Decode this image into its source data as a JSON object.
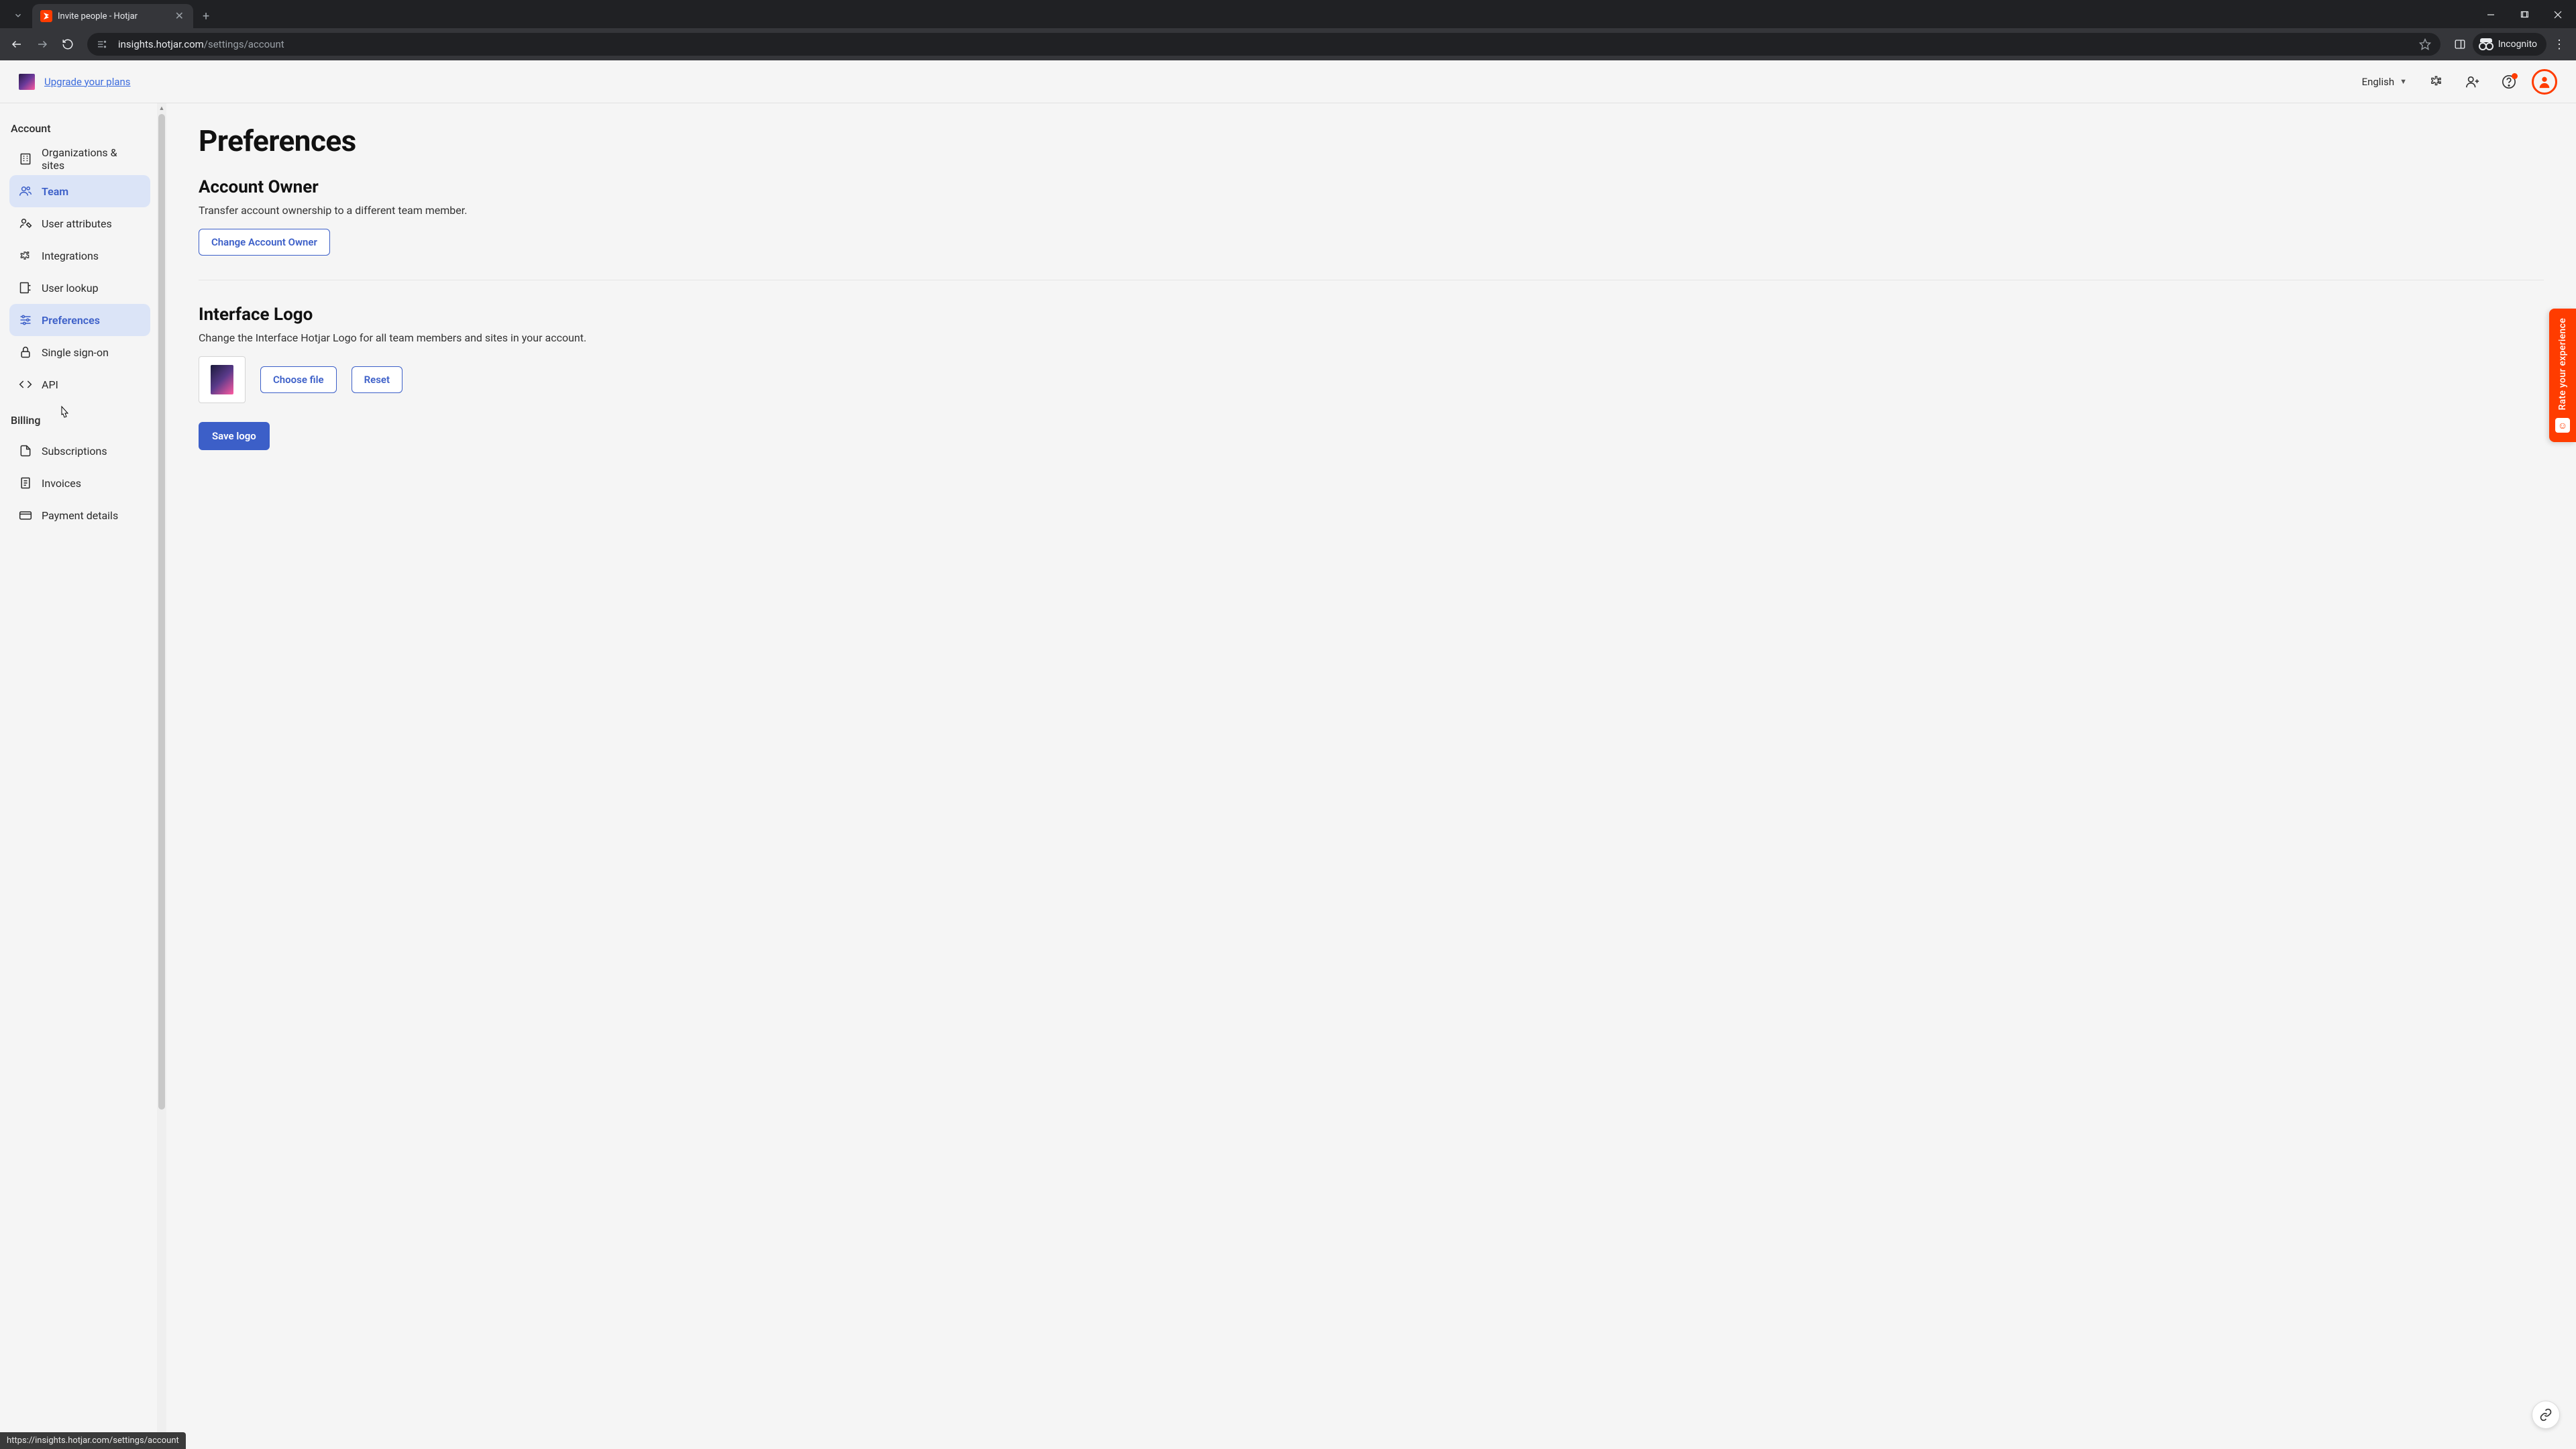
{
  "browser": {
    "tab_title": "Invite people - Hotjar",
    "url_host": "insights.hotjar.com",
    "url_path": "/settings/account",
    "incognito_label": "Incognito",
    "status_bar": "https://insights.hotjar.com/settings/account"
  },
  "topnav": {
    "upgrade": "Upgrade your plans",
    "language": "English"
  },
  "sidebar": {
    "group_account": "Account",
    "group_billing": "Billing",
    "items": {
      "org_sites": "Organizations & sites",
      "team": "Team",
      "user_attributes": "User attributes",
      "integrations": "Integrations",
      "user_lookup": "User lookup",
      "preferences": "Preferences",
      "sso": "Single sign-on",
      "api": "API",
      "subscriptions": "Subscriptions",
      "invoices": "Invoices",
      "payment_details": "Payment details"
    }
  },
  "main": {
    "title": "Preferences",
    "owner": {
      "heading": "Account Owner",
      "desc": "Transfer account ownership to a different team member.",
      "button": "Change Account Owner"
    },
    "logo": {
      "heading": "Interface Logo",
      "desc": "Change the Interface Hotjar Logo for all team members and sites in your account.",
      "choose": "Choose file",
      "reset": "Reset",
      "save": "Save logo"
    }
  },
  "feedback": {
    "label": "Rate your experience"
  }
}
